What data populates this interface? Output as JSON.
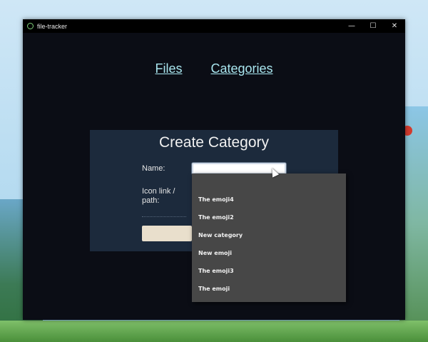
{
  "window": {
    "title": "file-tracker",
    "controls": {
      "minimize": "—",
      "maximize": "☐",
      "close": "✕"
    }
  },
  "nav": {
    "files": "Files",
    "categories": "Categories"
  },
  "form": {
    "title": "Create Category",
    "name_label": "Name:",
    "name_value": "",
    "icon_label": "Icon link / path:"
  },
  "autocomplete": {
    "items": [
      "The emoji4",
      "The emoji2",
      "New category",
      "New emoji",
      "The emoji3",
      "The emoji"
    ]
  },
  "colors": {
    "window_bg": "#0b0d15",
    "card_bg": "#1c2a3c",
    "link": "#a9e6ef",
    "dropdown_bg": "#474747",
    "button_bg": "#e9dfcc"
  }
}
